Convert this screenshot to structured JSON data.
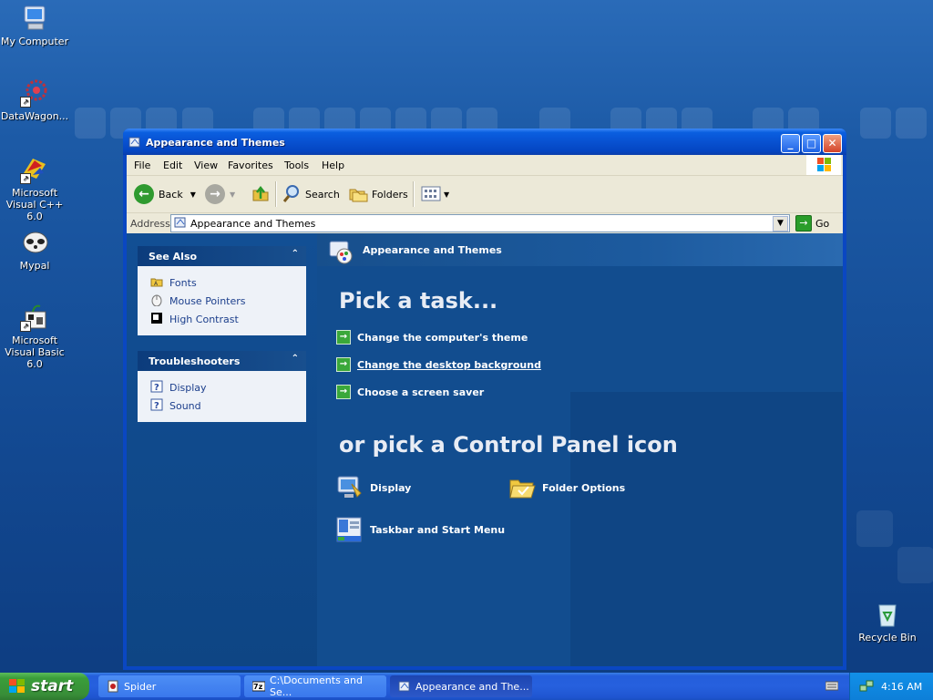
{
  "desktop": {
    "icons": [
      {
        "label": "My Computer"
      },
      {
        "label": "DataWagon..."
      },
      {
        "label": "Microsoft Visual C++ 6.0"
      },
      {
        "label": "Mypal"
      },
      {
        "label": "Microsoft Visual Basic 6.0"
      },
      {
        "label": "Recycle Bin"
      }
    ]
  },
  "window": {
    "title": "Appearance and Themes",
    "menu": [
      "File",
      "Edit",
      "View",
      "Favorites",
      "Tools",
      "Help"
    ],
    "toolbar": {
      "back_label": "Back",
      "search_label": "Search",
      "folders_label": "Folders"
    },
    "address": {
      "label": "Address",
      "value": "Appearance and Themes",
      "go_label": "Go"
    },
    "left_pane": {
      "see_also": {
        "title": "See Also",
        "items": [
          "Fonts",
          "Mouse Pointers",
          "High Contrast"
        ]
      },
      "troubleshooters": {
        "title": "Troubleshooters",
        "items": [
          "Display",
          "Sound"
        ]
      }
    },
    "main": {
      "header_title": "Appearance and Themes",
      "pick_task_heading": "Pick a task...",
      "tasks": [
        "Change the computer's theme",
        "Change the desktop background",
        "Choose a screen saver"
      ],
      "pick_icon_heading": "or pick a Control Panel icon",
      "icons": [
        "Display",
        "Folder Options",
        "Taskbar and Start Menu"
      ]
    }
  },
  "taskbar": {
    "start_label": "start",
    "buttons": [
      "Spider",
      "C:\\Documents and Se...",
      "Appearance and The..."
    ],
    "clock": "4:16 AM"
  },
  "colors": {
    "accent_blue": "#0a47c2",
    "task_green": "#3aa83a",
    "start_green": "#3a9e3a"
  }
}
